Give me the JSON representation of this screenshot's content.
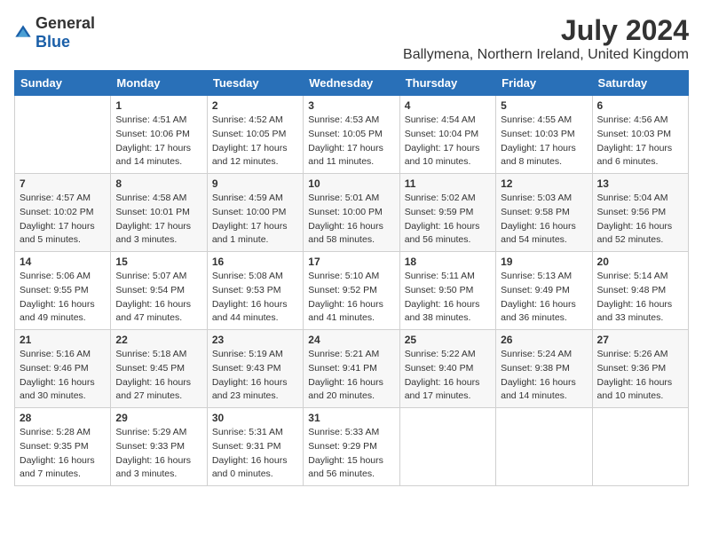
{
  "logo": {
    "general": "General",
    "blue": "Blue"
  },
  "title": "July 2024",
  "subtitle": "Ballymena, Northern Ireland, United Kingdom",
  "days_of_week": [
    "Sunday",
    "Monday",
    "Tuesday",
    "Wednesday",
    "Thursday",
    "Friday",
    "Saturday"
  ],
  "weeks": [
    [
      {
        "day": "",
        "sunrise": "",
        "sunset": "",
        "daylight": ""
      },
      {
        "day": "1",
        "sunrise": "Sunrise: 4:51 AM",
        "sunset": "Sunset: 10:06 PM",
        "daylight": "Daylight: 17 hours and 14 minutes."
      },
      {
        "day": "2",
        "sunrise": "Sunrise: 4:52 AM",
        "sunset": "Sunset: 10:05 PM",
        "daylight": "Daylight: 17 hours and 12 minutes."
      },
      {
        "day": "3",
        "sunrise": "Sunrise: 4:53 AM",
        "sunset": "Sunset: 10:05 PM",
        "daylight": "Daylight: 17 hours and 11 minutes."
      },
      {
        "day": "4",
        "sunrise": "Sunrise: 4:54 AM",
        "sunset": "Sunset: 10:04 PM",
        "daylight": "Daylight: 17 hours and 10 minutes."
      },
      {
        "day": "5",
        "sunrise": "Sunrise: 4:55 AM",
        "sunset": "Sunset: 10:03 PM",
        "daylight": "Daylight: 17 hours and 8 minutes."
      },
      {
        "day": "6",
        "sunrise": "Sunrise: 4:56 AM",
        "sunset": "Sunset: 10:03 PM",
        "daylight": "Daylight: 17 hours and 6 minutes."
      }
    ],
    [
      {
        "day": "7",
        "sunrise": "Sunrise: 4:57 AM",
        "sunset": "Sunset: 10:02 PM",
        "daylight": "Daylight: 17 hours and 5 minutes."
      },
      {
        "day": "8",
        "sunrise": "Sunrise: 4:58 AM",
        "sunset": "Sunset: 10:01 PM",
        "daylight": "Daylight: 17 hours and 3 minutes."
      },
      {
        "day": "9",
        "sunrise": "Sunrise: 4:59 AM",
        "sunset": "Sunset: 10:00 PM",
        "daylight": "Daylight: 17 hours and 1 minute."
      },
      {
        "day": "10",
        "sunrise": "Sunrise: 5:01 AM",
        "sunset": "Sunset: 10:00 PM",
        "daylight": "Daylight: 16 hours and 58 minutes."
      },
      {
        "day": "11",
        "sunrise": "Sunrise: 5:02 AM",
        "sunset": "Sunset: 9:59 PM",
        "daylight": "Daylight: 16 hours and 56 minutes."
      },
      {
        "day": "12",
        "sunrise": "Sunrise: 5:03 AM",
        "sunset": "Sunset: 9:58 PM",
        "daylight": "Daylight: 16 hours and 54 minutes."
      },
      {
        "day": "13",
        "sunrise": "Sunrise: 5:04 AM",
        "sunset": "Sunset: 9:56 PM",
        "daylight": "Daylight: 16 hours and 52 minutes."
      }
    ],
    [
      {
        "day": "14",
        "sunrise": "Sunrise: 5:06 AM",
        "sunset": "Sunset: 9:55 PM",
        "daylight": "Daylight: 16 hours and 49 minutes."
      },
      {
        "day": "15",
        "sunrise": "Sunrise: 5:07 AM",
        "sunset": "Sunset: 9:54 PM",
        "daylight": "Daylight: 16 hours and 47 minutes."
      },
      {
        "day": "16",
        "sunrise": "Sunrise: 5:08 AM",
        "sunset": "Sunset: 9:53 PM",
        "daylight": "Daylight: 16 hours and 44 minutes."
      },
      {
        "day": "17",
        "sunrise": "Sunrise: 5:10 AM",
        "sunset": "Sunset: 9:52 PM",
        "daylight": "Daylight: 16 hours and 41 minutes."
      },
      {
        "day": "18",
        "sunrise": "Sunrise: 5:11 AM",
        "sunset": "Sunset: 9:50 PM",
        "daylight": "Daylight: 16 hours and 38 minutes."
      },
      {
        "day": "19",
        "sunrise": "Sunrise: 5:13 AM",
        "sunset": "Sunset: 9:49 PM",
        "daylight": "Daylight: 16 hours and 36 minutes."
      },
      {
        "day": "20",
        "sunrise": "Sunrise: 5:14 AM",
        "sunset": "Sunset: 9:48 PM",
        "daylight": "Daylight: 16 hours and 33 minutes."
      }
    ],
    [
      {
        "day": "21",
        "sunrise": "Sunrise: 5:16 AM",
        "sunset": "Sunset: 9:46 PM",
        "daylight": "Daylight: 16 hours and 30 minutes."
      },
      {
        "day": "22",
        "sunrise": "Sunrise: 5:18 AM",
        "sunset": "Sunset: 9:45 PM",
        "daylight": "Daylight: 16 hours and 27 minutes."
      },
      {
        "day": "23",
        "sunrise": "Sunrise: 5:19 AM",
        "sunset": "Sunset: 9:43 PM",
        "daylight": "Daylight: 16 hours and 23 minutes."
      },
      {
        "day": "24",
        "sunrise": "Sunrise: 5:21 AM",
        "sunset": "Sunset: 9:41 PM",
        "daylight": "Daylight: 16 hours and 20 minutes."
      },
      {
        "day": "25",
        "sunrise": "Sunrise: 5:22 AM",
        "sunset": "Sunset: 9:40 PM",
        "daylight": "Daylight: 16 hours and 17 minutes."
      },
      {
        "day": "26",
        "sunrise": "Sunrise: 5:24 AM",
        "sunset": "Sunset: 9:38 PM",
        "daylight": "Daylight: 16 hours and 14 minutes."
      },
      {
        "day": "27",
        "sunrise": "Sunrise: 5:26 AM",
        "sunset": "Sunset: 9:36 PM",
        "daylight": "Daylight: 16 hours and 10 minutes."
      }
    ],
    [
      {
        "day": "28",
        "sunrise": "Sunrise: 5:28 AM",
        "sunset": "Sunset: 9:35 PM",
        "daylight": "Daylight: 16 hours and 7 minutes."
      },
      {
        "day": "29",
        "sunrise": "Sunrise: 5:29 AM",
        "sunset": "Sunset: 9:33 PM",
        "daylight": "Daylight: 16 hours and 3 minutes."
      },
      {
        "day": "30",
        "sunrise": "Sunrise: 5:31 AM",
        "sunset": "Sunset: 9:31 PM",
        "daylight": "Daylight: 16 hours and 0 minutes."
      },
      {
        "day": "31",
        "sunrise": "Sunrise: 5:33 AM",
        "sunset": "Sunset: 9:29 PM",
        "daylight": "Daylight: 15 hours and 56 minutes."
      },
      {
        "day": "",
        "sunrise": "",
        "sunset": "",
        "daylight": ""
      },
      {
        "day": "",
        "sunrise": "",
        "sunset": "",
        "daylight": ""
      },
      {
        "day": "",
        "sunrise": "",
        "sunset": "",
        "daylight": ""
      }
    ]
  ]
}
